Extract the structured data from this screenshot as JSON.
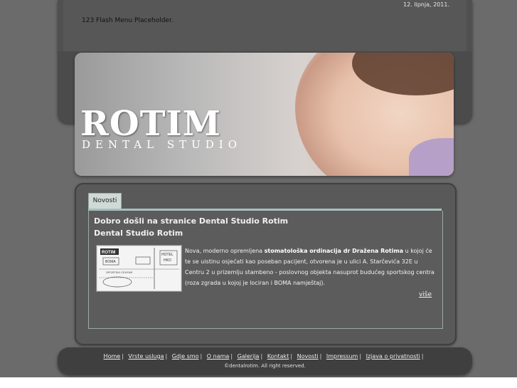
{
  "header": {
    "date": "12. lipnja, 2011.",
    "flash_placeholder": "123 Flash Menu Placeholder."
  },
  "banner": {
    "logo_word": "ROTIM",
    "logo_sub": "DENTAL STUDIO"
  },
  "content": {
    "tab_label": "Novosti",
    "title": "Dobro došli na stranice Dental Studio Rotim",
    "subtitle": "Dental Studio Rotim",
    "para_prefix": "Nova, moderno opremljena ",
    "para_bold": "stomatološka ordinacija dr Dražena Rotima",
    "para_suffix": " u kojoj će te se uistinu osjećati kao poseban pacijent, otvorena je u ulici A. Starčevića 32E u Centru 2 u prizemlju stambeno - poslovnog objekta nasuprot budućeg sportskog centra (roza zgrada u kojoj je lociran i BOMA namještaj).",
    "more_link": "više",
    "thumb_labels": [
      "ROTIM",
      "BOMA",
      "HOTEL",
      "HKO",
      "SPORTSKI CENTAR"
    ]
  },
  "footer": {
    "links": [
      "Home",
      "Vrste usluga",
      "Gdje smo",
      "O nama",
      "Galerija",
      "Kontakt",
      "Novosti",
      "Impressum",
      "Izjava o privatnosti"
    ],
    "separator": "|",
    "copyright": "©dentalrotim. All right reserved."
  }
}
